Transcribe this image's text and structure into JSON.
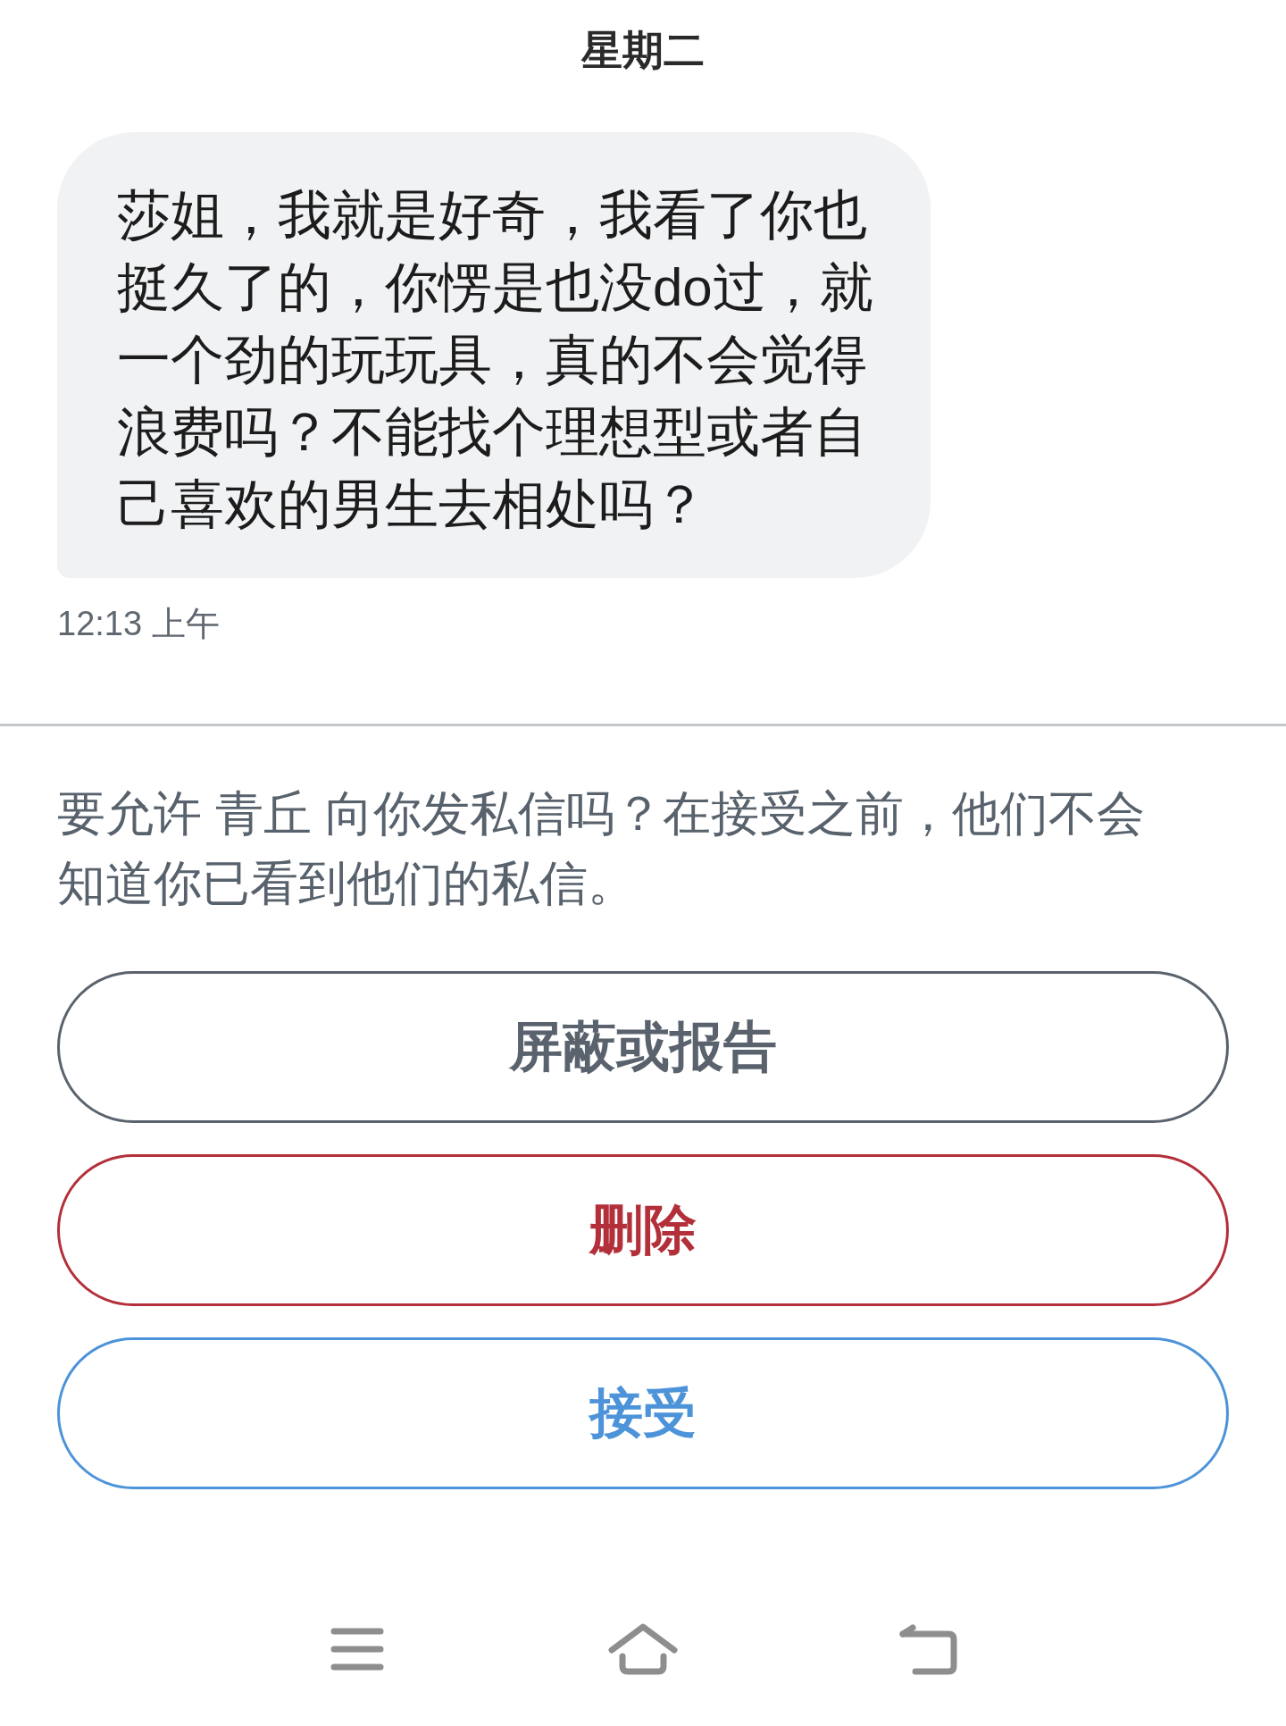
{
  "header": {
    "title": "星期二"
  },
  "message": {
    "text": "莎姐，我就是好奇，我看了你也挺久了的，你愣是也没do过，就一个劲的玩玩具，真的不会觉得浪费吗？不能找个理想型或者自己喜欢的男生去相处吗？",
    "time": "12:13 上午"
  },
  "request": {
    "text": "要允许 青丘 向你发私信吗？在接受之前，他们不会知道你已看到他们的私信。"
  },
  "actions": [
    {
      "label": "屏蔽或报告",
      "kind": "neutral"
    },
    {
      "label": "删除",
      "kind": "danger"
    },
    {
      "label": "接受",
      "kind": "primary"
    }
  ]
}
